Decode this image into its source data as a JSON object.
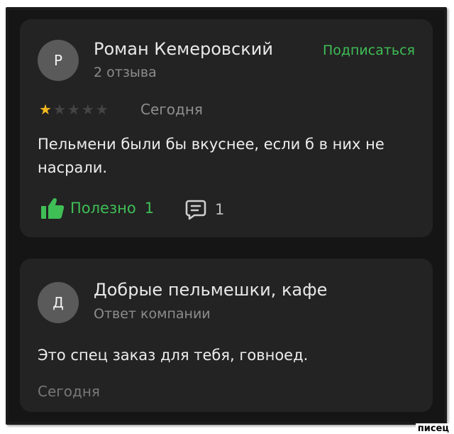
{
  "review": {
    "author_initial": "Р",
    "author_name": "Роман Кемеровский",
    "author_reviews": "2 отзыва",
    "subscribe_label": "Подписаться",
    "rating": 1,
    "rating_max": 5,
    "date": "Сегодня",
    "text": "Пельмени были бы вкуснее, если б в них не насрали.",
    "useful_label": "Полезно",
    "useful_count": "1",
    "comments_count": "1"
  },
  "reply": {
    "author_initial": "Д",
    "author_name": "Добрые пельмешки, кафе",
    "author_role": "Ответ компании",
    "text": "Это спец заказ для тебя, говноед.",
    "date": "Сегодня"
  },
  "watermark": "писец",
  "colors": {
    "background": "#151515",
    "card": "#232323",
    "accent_green": "#3fbe56",
    "star_active": "#f3b81e",
    "star_inactive": "#444444"
  },
  "icons": {
    "useful": "thumbs-up-icon",
    "comments": "comment-icon",
    "star": "star-icon"
  }
}
